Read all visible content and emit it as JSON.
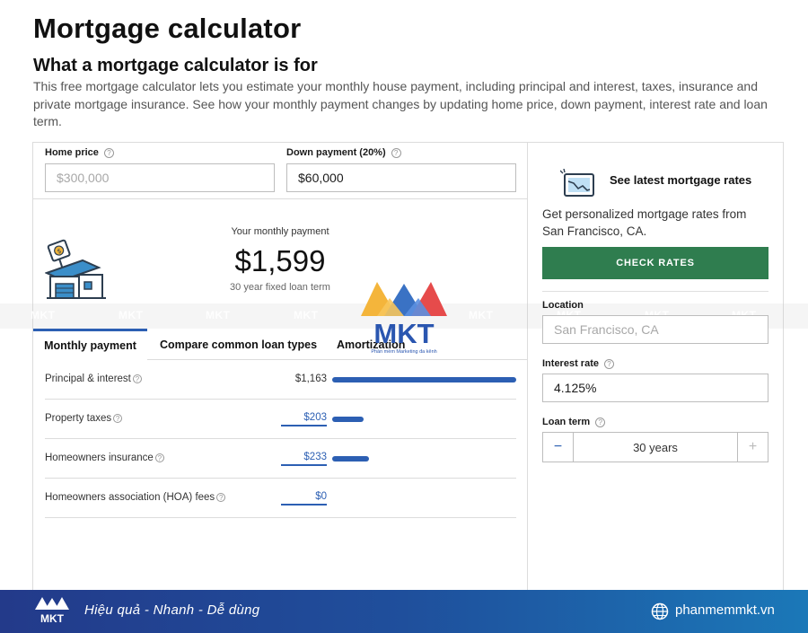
{
  "page": {
    "title": "Mortgage calculator",
    "subtitle": "What a mortgage calculator is for",
    "intro": "This free mortgage calculator lets you estimate your monthly house payment, including principal and interest, taxes, insurance and private mortgage insurance. See how your monthly payment changes by updating home price, down payment, interest rate and loan term."
  },
  "calculator": {
    "home_price": {
      "label": "Home price",
      "placeholder": "$300,000",
      "value": ""
    },
    "down_payment": {
      "label": "Down payment (20%)",
      "value": "$60,000"
    },
    "monthly": {
      "label": "Your monthly payment",
      "amount": "$1,599",
      "term_note": "30 year fixed loan term"
    },
    "tabs": [
      {
        "label": "Monthly payment",
        "active": true
      },
      {
        "label": "Compare common loan types",
        "active": false
      },
      {
        "label": "Amortization",
        "active": false
      }
    ],
    "breakdown": [
      {
        "label": "Principal & interest",
        "value": "$1,163",
        "editable": false,
        "share": 0.727
      },
      {
        "label": "Property taxes",
        "value": "$203",
        "editable": true,
        "share": 0.127
      },
      {
        "label": "Homeowners insurance",
        "value": "$233",
        "editable": true,
        "share": 0.146
      },
      {
        "label": "Homeowners association (HOA) fees",
        "value": "$0",
        "editable": true,
        "share": 0
      }
    ]
  },
  "rates_panel": {
    "title": "See latest mortgage rates",
    "description": "Get personalized mortgage rates from San Francisco, CA.",
    "cta": "CHECK RATES",
    "location": {
      "label": "Location",
      "placeholder": "San Francisco, CA"
    },
    "interest_rate": {
      "label": "Interest rate",
      "value": "4.125%"
    },
    "loan_term": {
      "label": "Loan term",
      "value": "30 years",
      "minus": "−",
      "plus": "+"
    }
  },
  "watermark": {
    "brand": "MKT",
    "tagline": "Phần mềm Marketing đa kênh"
  },
  "footer": {
    "tagline": "Hiệu quả - Nhanh - Dễ dùng",
    "site": "phanmemmkt.vn"
  },
  "colors": {
    "accent_blue": "#2c5fb3",
    "cta_green": "#2f7d4f",
    "footer_start": "#233a8a",
    "footer_end": "#1b78b8"
  },
  "icons": [
    "house-dollar-icon",
    "rates-chart-icon",
    "help-icon",
    "globe-icon",
    "mkt-logo-icon"
  ]
}
